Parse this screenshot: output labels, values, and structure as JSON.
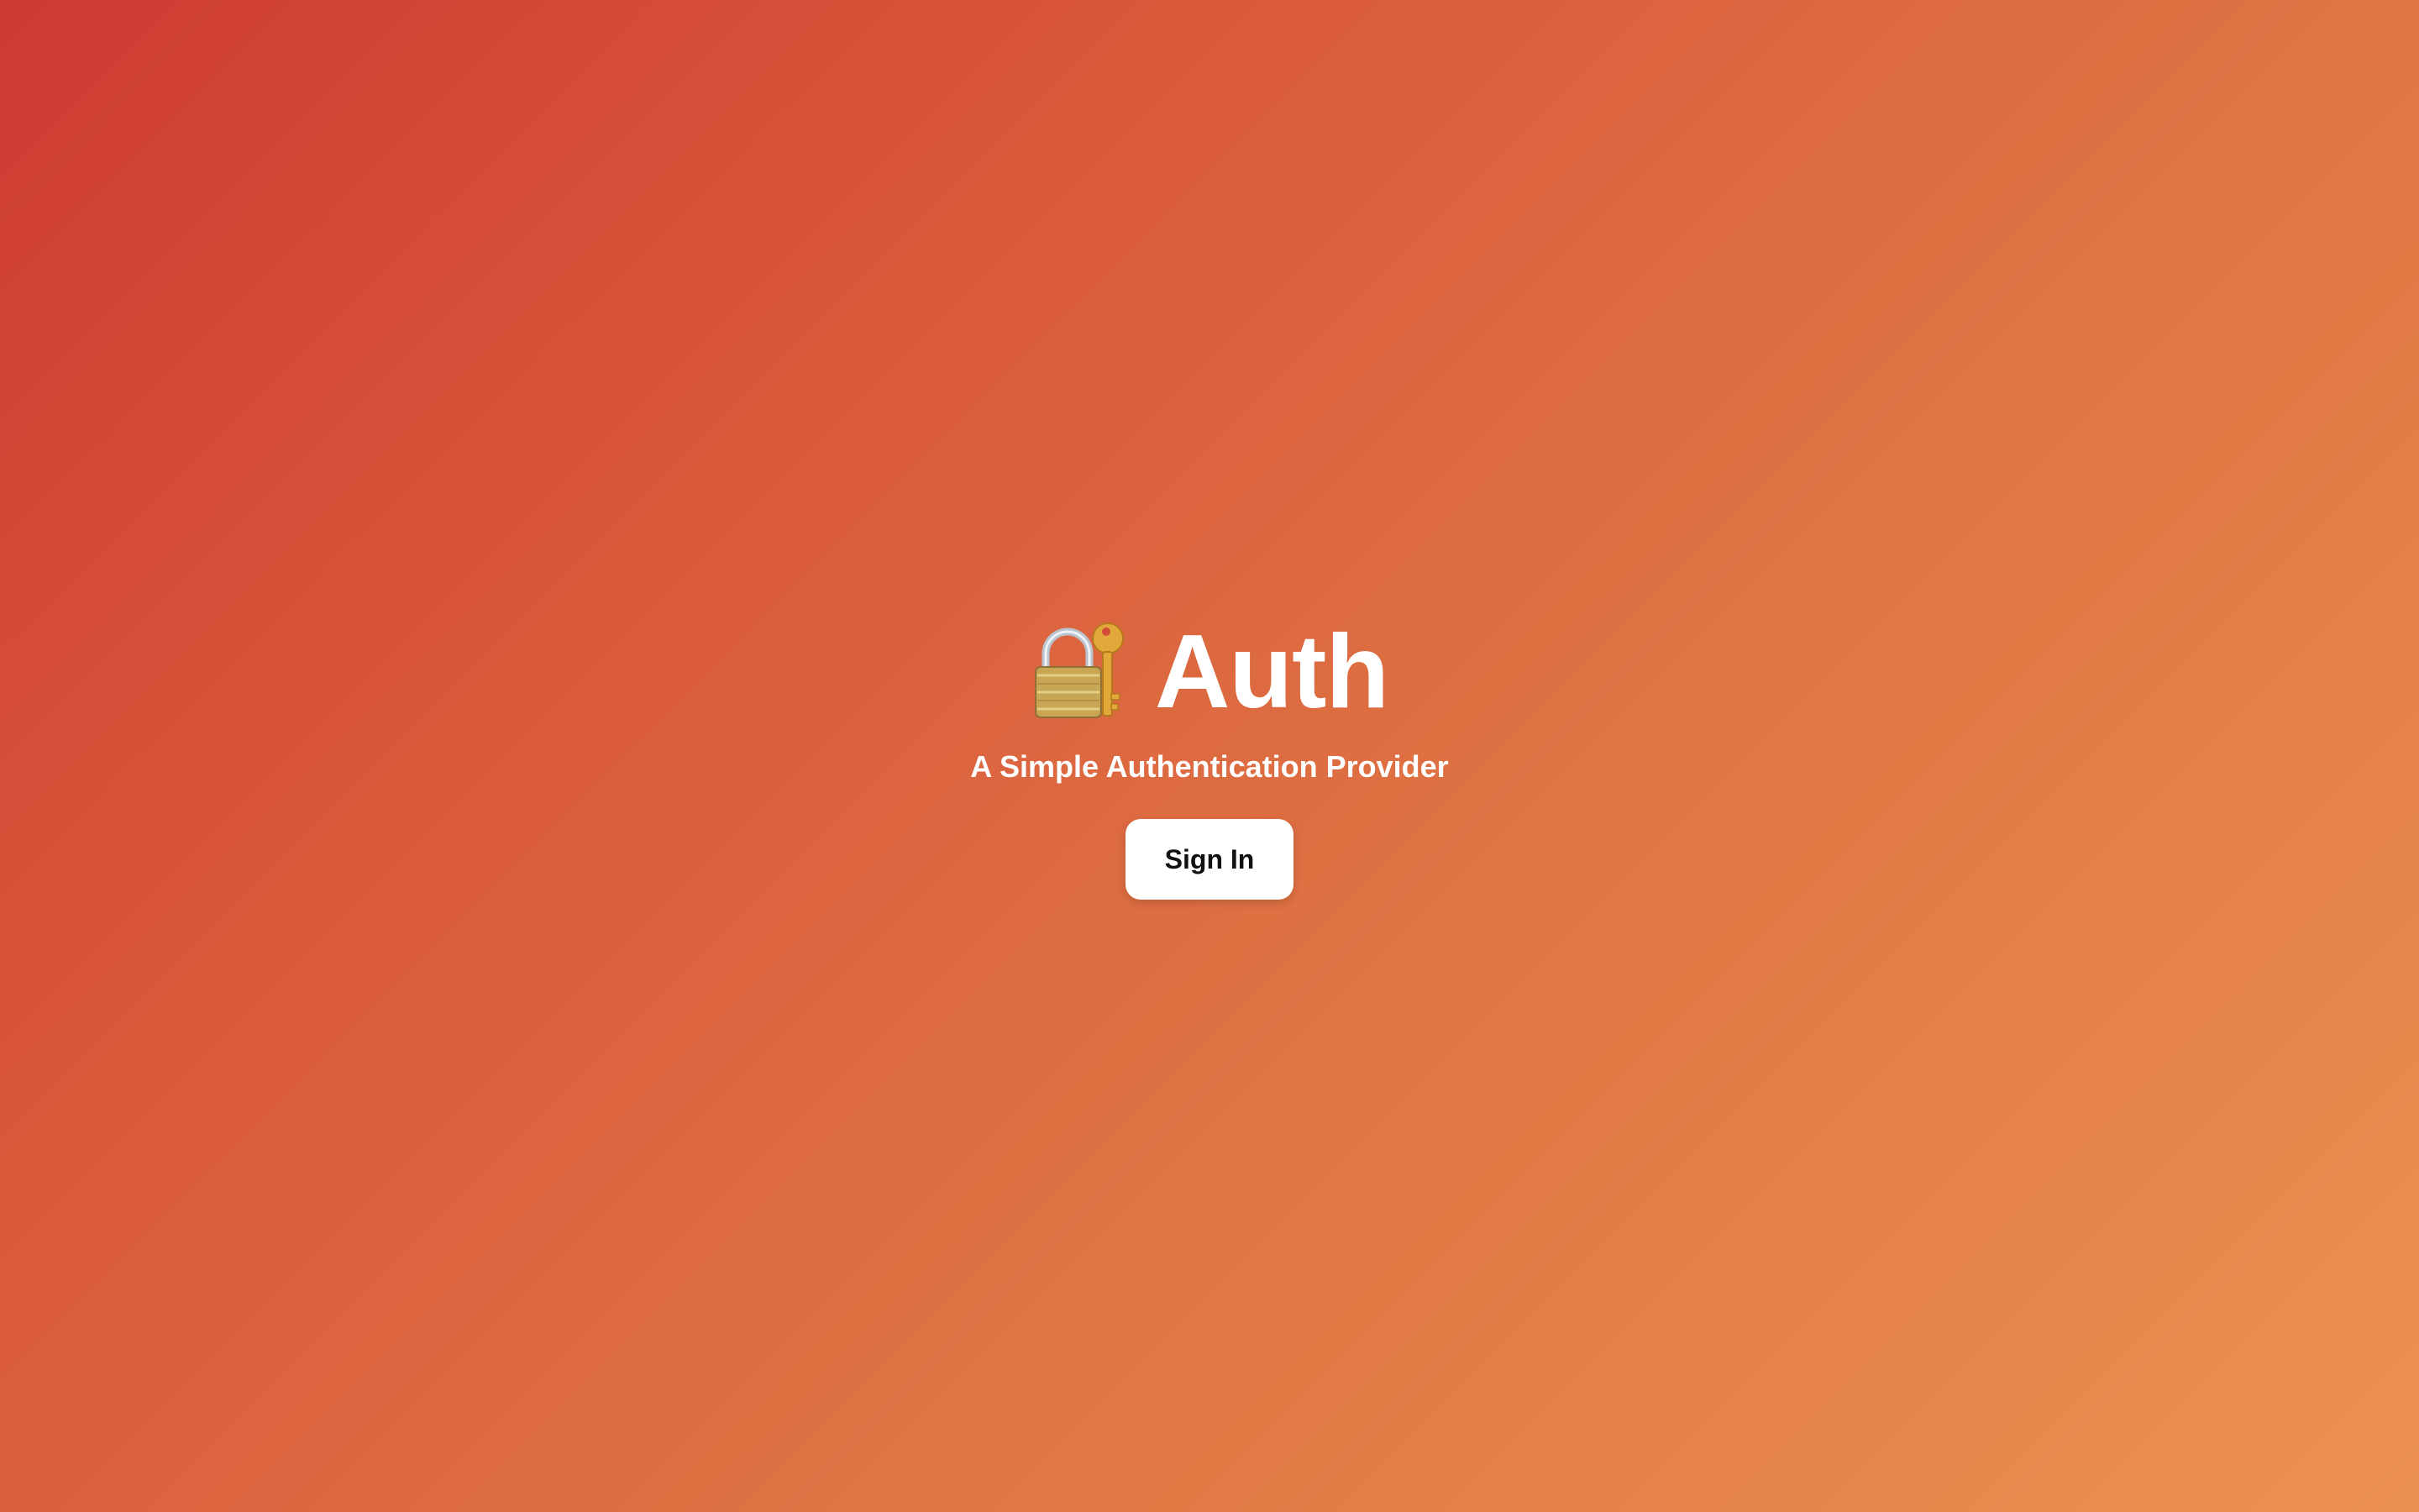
{
  "page": {
    "title": "Auth",
    "icon": "locked-with-key-icon",
    "subtitle": "A Simple Authentication Provider",
    "signin_label": "Sign In"
  },
  "colors": {
    "gradient_start": "#cd3a33",
    "gradient_end": "#ec9250",
    "text": "#ffffff",
    "button_bg": "#ffffff",
    "button_text": "#111111"
  }
}
